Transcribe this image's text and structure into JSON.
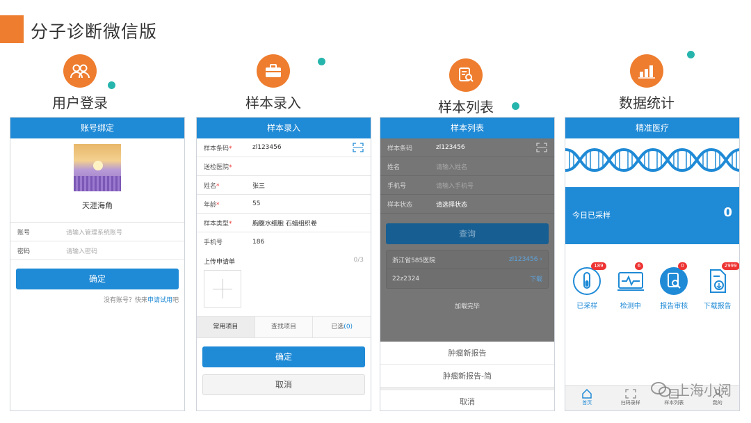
{
  "page": {
    "title": "分子诊断微信版"
  },
  "features": [
    {
      "label": "用户登录",
      "icon": "users-icon"
    },
    {
      "label": "样本录入",
      "icon": "briefcase-icon"
    },
    {
      "label": "样本列表",
      "icon": "document-search-icon"
    },
    {
      "label": "数据统计",
      "icon": "bar-chart-icon"
    }
  ],
  "login": {
    "header": "账号绑定",
    "nickname": "天涯海角",
    "account_label": "账号",
    "account_placeholder": "请输入管理系统账号",
    "password_label": "密码",
    "password_placeholder": "请输入密码",
    "confirm": "确定",
    "no_account": "没有账号？快来",
    "apply": "申请试用",
    "apply_suffix": "吧"
  },
  "entry": {
    "header": "样本录入",
    "fields": [
      {
        "label": "样本条码",
        "required": true,
        "value": "zl123456"
      },
      {
        "label": "送检医院",
        "required": true,
        "value": ""
      },
      {
        "label": "姓名",
        "required": true,
        "value": "张三"
      },
      {
        "label": "年龄",
        "required": true,
        "value": "55"
      },
      {
        "label": "样本类型",
        "required": true,
        "value": "胸腹水细胞 石蜡组织卷"
      },
      {
        "label": "手机号",
        "required": false,
        "value": "186"
      }
    ],
    "upload_label": "上传申请单",
    "upload_count": "0/3",
    "tabs": [
      {
        "label": "常用项目"
      },
      {
        "label": "查找项目"
      },
      {
        "label": "已选",
        "num": "0"
      }
    ],
    "confirm": "确定",
    "cancel": "取消"
  },
  "list": {
    "header": "样本列表",
    "fields": [
      {
        "label": "样本条码",
        "value": "zl123456"
      },
      {
        "label": "姓名",
        "value": "请输入姓名"
      },
      {
        "label": "手机号",
        "value": "请输入手机号"
      },
      {
        "label": "样本状态",
        "value": "请选择状态"
      }
    ],
    "query": "查询",
    "result_hospital": "浙江省585医院",
    "result_code": "zl123456",
    "result_id": "22z2324",
    "result_download": "下载",
    "loaded": "加载完毕",
    "sheet": [
      "肿瘤新报告",
      "肿瘤新报告-简",
      "取消"
    ]
  },
  "stats": {
    "header": "精准医疗",
    "today_label": "今日已采样",
    "today_value": "0",
    "items": [
      {
        "label": "已采样",
        "badge": "189"
      },
      {
        "label": "检测中",
        "badge": "6"
      },
      {
        "label": "报告审核",
        "badge": "0"
      },
      {
        "label": "下载报告",
        "badge": "2999"
      }
    ],
    "nav": [
      "首页",
      "扫码录样",
      "样本列表",
      "我的"
    ]
  },
  "watermark": "上海小阅",
  "colors": {
    "accent": "#ee7d2f",
    "primary": "#1f8ad6",
    "dot": "#26b5ad"
  }
}
